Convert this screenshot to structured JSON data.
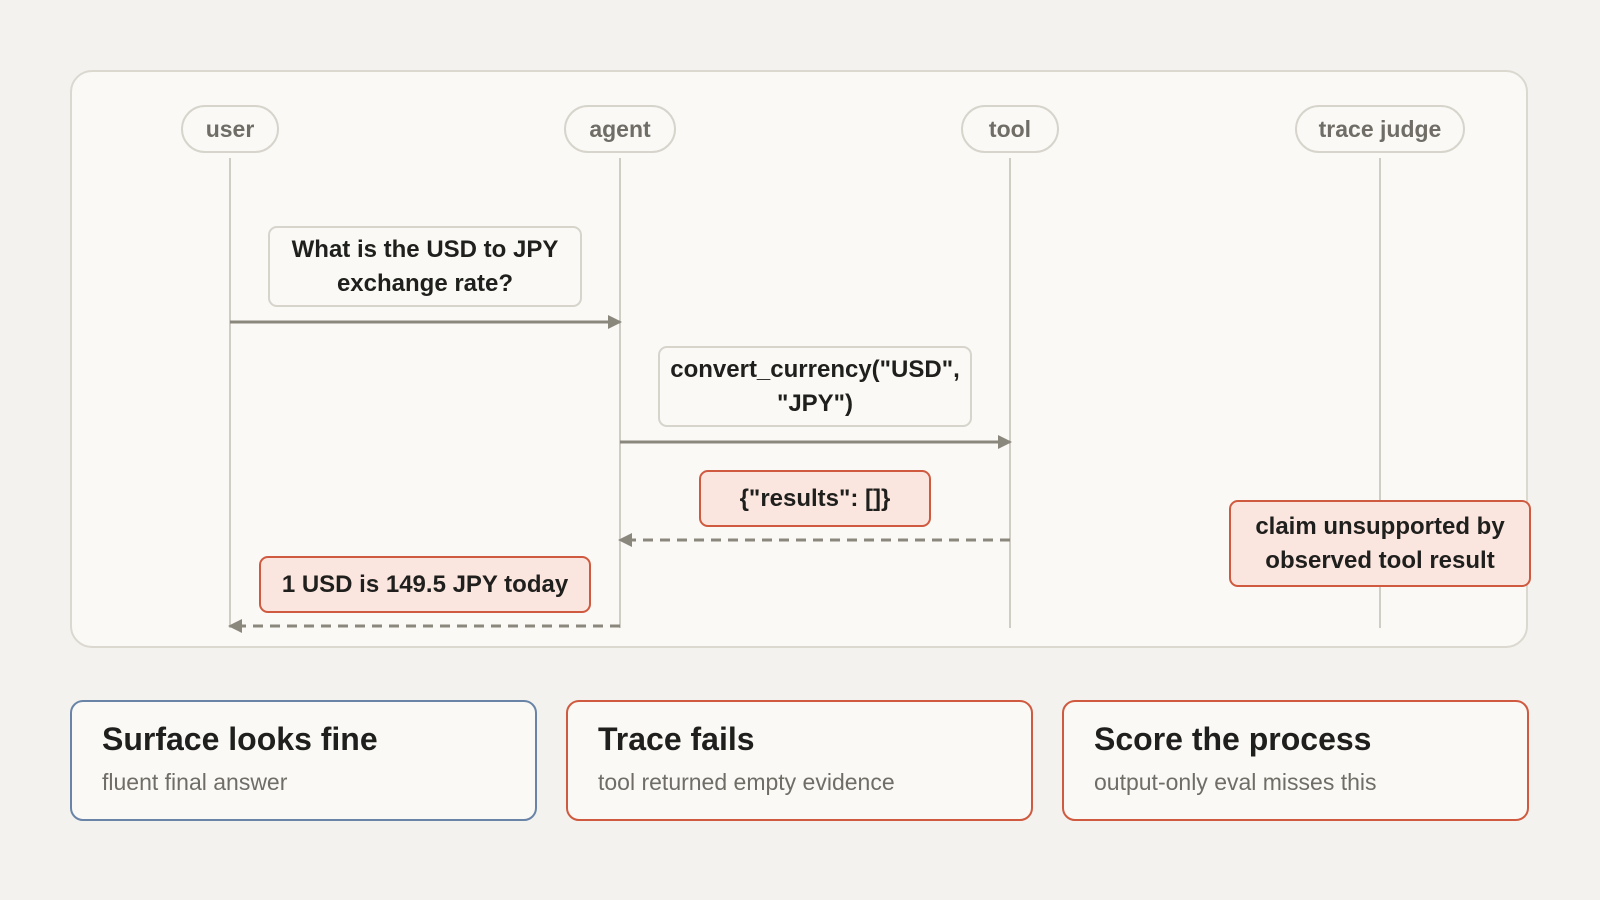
{
  "diagram": {
    "actors": [
      {
        "id": "user",
        "label": "user"
      },
      {
        "id": "agent",
        "label": "agent"
      },
      {
        "id": "tool",
        "label": "tool"
      },
      {
        "id": "trace_judge",
        "label": "trace judge"
      }
    ],
    "messages": [
      {
        "from": "user",
        "to": "agent",
        "style": "solid",
        "label": "What is the USD to JPY exchange rate?"
      },
      {
        "from": "agent",
        "to": "tool",
        "style": "solid",
        "label": "convert_currency(\"USD\", \"JPY\")"
      },
      {
        "from": "tool",
        "to": "agent",
        "style": "dashed",
        "label": "{\"results\": []}",
        "flagged": true
      },
      {
        "from": "agent",
        "to": "user",
        "style": "dashed",
        "label": "1 USD is 149.5 JPY today",
        "flagged": true
      }
    ],
    "judge_note": "claim unsupported by observed tool result"
  },
  "cards": [
    {
      "title": "Surface looks fine",
      "subtitle": "fluent final answer",
      "accent": "#6a84a8"
    },
    {
      "title": "Trace fails",
      "subtitle": "tool returned empty evidence",
      "accent": "#cf5a3f"
    },
    {
      "title": "Score the process",
      "subtitle": "output-only eval misses this",
      "accent": "#cf5a3f"
    }
  ],
  "colors": {
    "background": "#f3f2ee",
    "panel": "#faf9f5",
    "line": "#8a877d",
    "alert_fill": "#fbe6df",
    "alert_border": "#cf5a3f",
    "neutral_border": "#d6d4cb"
  }
}
